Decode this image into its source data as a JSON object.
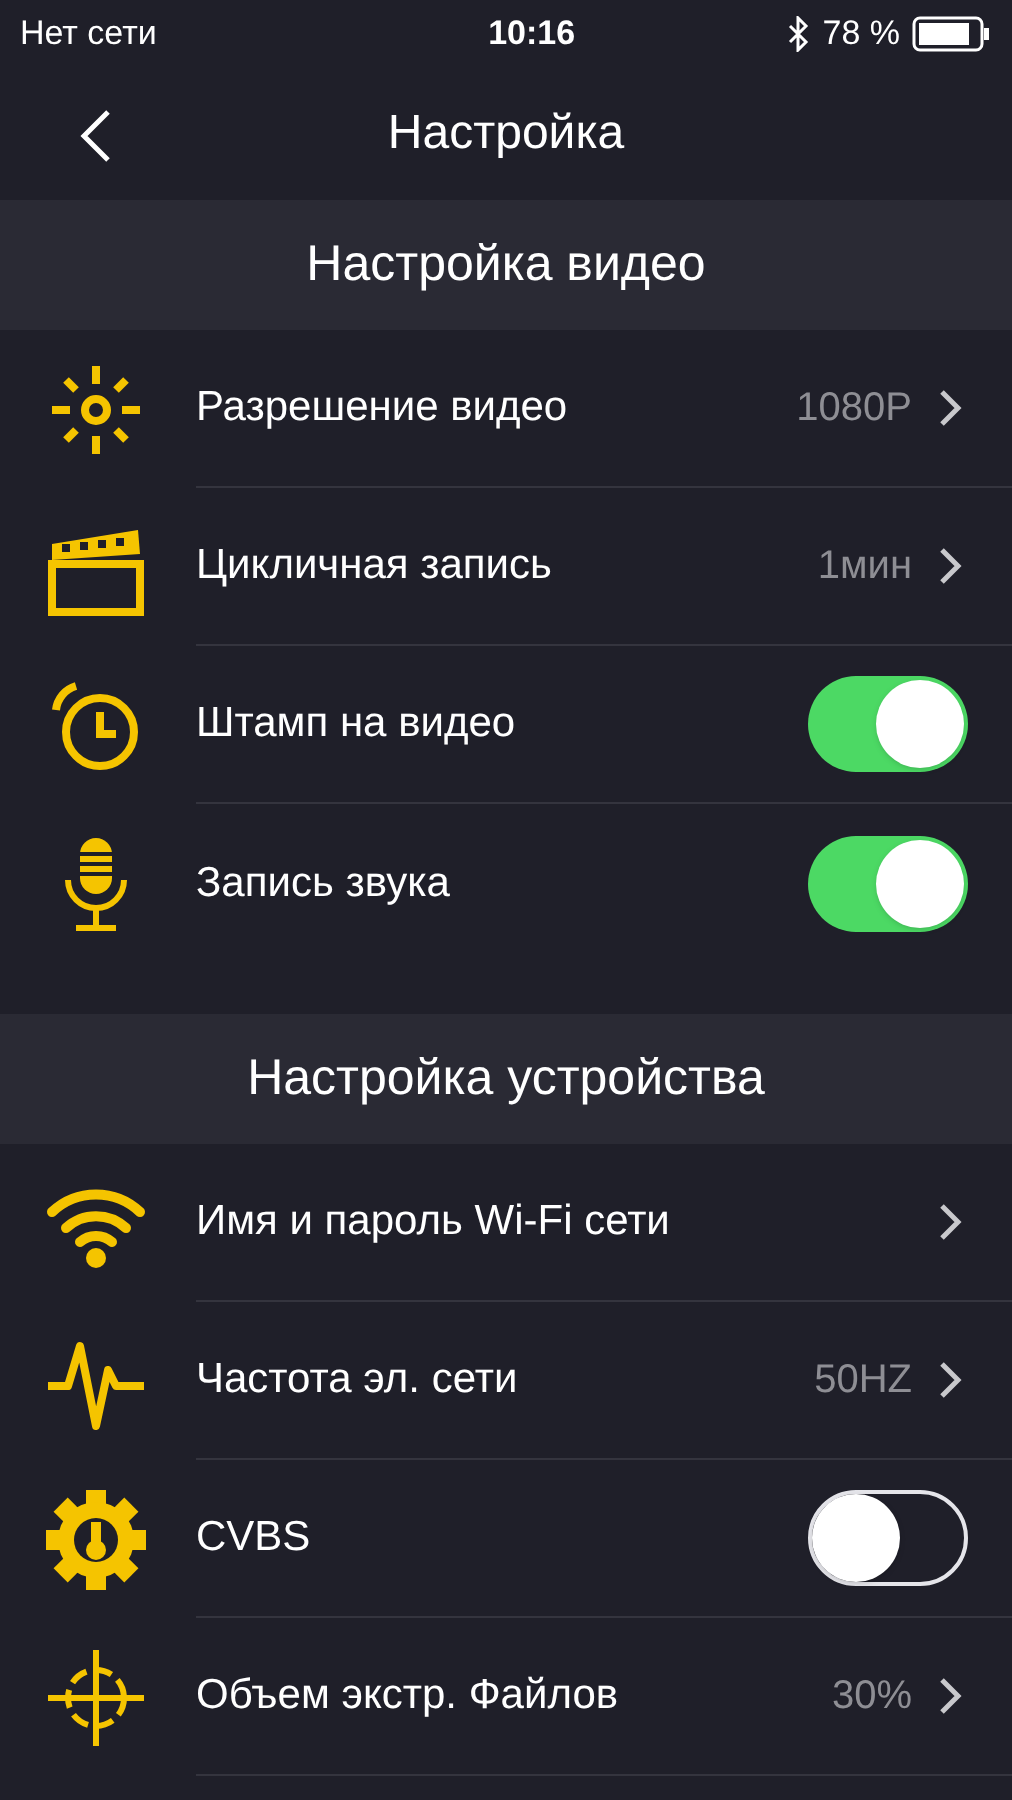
{
  "status_bar": {
    "carrier": "Нет сети",
    "time": "10:16",
    "battery": "78 %"
  },
  "nav": {
    "title": "Настройка"
  },
  "sections": [
    {
      "title": "Настройка видео",
      "rows": [
        {
          "label": "Разрешение видео",
          "kind": "link",
          "value": "1080P"
        },
        {
          "label": "Цикличная запись",
          "kind": "link",
          "value": "1мин"
        },
        {
          "label": "Штамп на видео",
          "kind": "toggle",
          "on": true
        },
        {
          "label": "Запись звука",
          "kind": "toggle",
          "on": true
        }
      ]
    },
    {
      "title": "Настройка устройства",
      "rows": [
        {
          "label": "Имя и пароль Wi-Fi сети",
          "kind": "link"
        },
        {
          "label": "Частота эл. сети",
          "kind": "link",
          "value": "50HZ"
        },
        {
          "label": "CVBS",
          "kind": "toggle",
          "on": false
        },
        {
          "label": "Объем экстр. Файлов",
          "kind": "link",
          "value": "30%"
        }
      ]
    }
  ]
}
